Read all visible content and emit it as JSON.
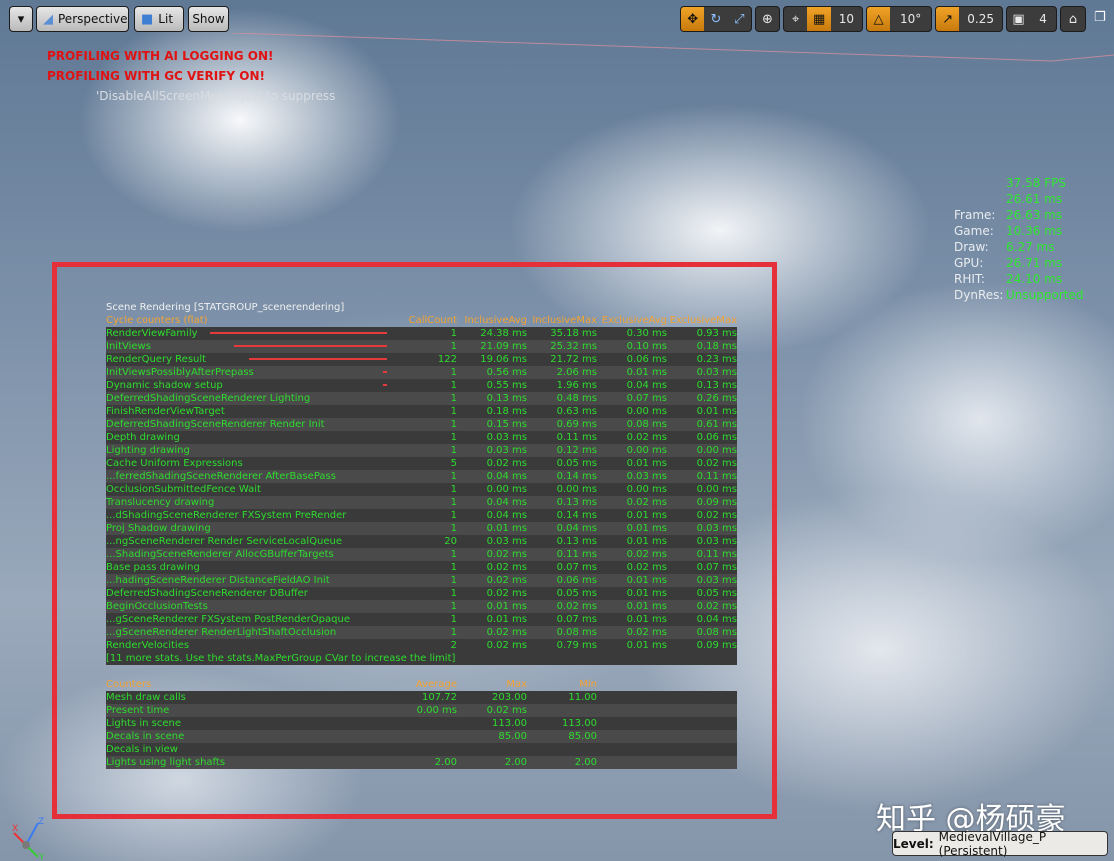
{
  "toolbar": {
    "menu_icon": "chevron-down-icon",
    "perspective_label": "Perspective",
    "lit_label": "Lit",
    "show_label": "Show",
    "grid_snap_value": "10",
    "rotation_snap_value": "10°",
    "scale_snap_value": "0.25",
    "camera_speed_value": "4"
  },
  "warnings": {
    "ai_logging": "PROFILING WITH AI LOGGING ON!",
    "gc_verify": "PROFILING WITH GC VERIFY ON!",
    "suppress_hint": "'DisableAllScreenMessages' to suppress"
  },
  "perf": {
    "fps": "37.58 FPS",
    "ms": "26.61 ms",
    "rows": [
      {
        "label": "Frame:",
        "value": "26.63 ms"
      },
      {
        "label": "Game:",
        "value": "10.36 ms"
      },
      {
        "label": "Draw:",
        "value": "6.27 ms"
      },
      {
        "label": "GPU:",
        "value": "26.71 ms"
      },
      {
        "label": "RHIT:",
        "value": "24.10 ms"
      },
      {
        "label": "DynRes:",
        "value": "Unsupported"
      }
    ]
  },
  "scene_stats": {
    "title": "Scene Rendering [STATGROUP_scenerendering]",
    "cycle_header": "Cycle counters (flat)",
    "columns": [
      "CallCount",
      "InclusiveAvg",
      "InclusiveMax",
      "ExclusiveAvg",
      "ExclusiveMax"
    ],
    "rows": [
      {
        "name": "RenderViewFamily",
        "count": "1",
        "inc_avg": "24.38 ms",
        "inc_max": "35.18 ms",
        "exc_avg": "0.30 ms",
        "exc_max": "0.93 ms",
        "bar": 1.0
      },
      {
        "name": "InitViews",
        "count": "1",
        "inc_avg": "21.09 ms",
        "inc_max": "25.32 ms",
        "exc_avg": "0.10 ms",
        "exc_max": "0.18 ms",
        "bar": 0.865
      },
      {
        "name": "RenderQuery Result",
        "count": "122",
        "inc_avg": "19.06 ms",
        "inc_max": "21.72 ms",
        "exc_avg": "0.06 ms",
        "exc_max": "0.23 ms",
        "bar": 0.78
      },
      {
        "name": "InitViewsPossiblyAfterPrepass",
        "count": "1",
        "inc_avg": "0.56 ms",
        "inc_max": "2.06 ms",
        "exc_avg": "0.01 ms",
        "exc_max": "0.03 ms",
        "bar": 0.023
      },
      {
        "name": "Dynamic shadow setup",
        "count": "1",
        "inc_avg": "0.55 ms",
        "inc_max": "1.96 ms",
        "exc_avg": "0.04 ms",
        "exc_max": "0.13 ms",
        "bar": 0.022
      },
      {
        "name": "DeferredShadingSceneRenderer Lighting",
        "count": "1",
        "inc_avg": "0.13 ms",
        "inc_max": "0.48 ms",
        "exc_avg": "0.07 ms",
        "exc_max": "0.26 ms",
        "bar": 0
      },
      {
        "name": "FinishRenderViewTarget",
        "count": "1",
        "inc_avg": "0.18 ms",
        "inc_max": "0.63 ms",
        "exc_avg": "0.00 ms",
        "exc_max": "0.01 ms",
        "bar": 0
      },
      {
        "name": "DeferredShadingSceneRenderer Render Init",
        "count": "1",
        "inc_avg": "0.15 ms",
        "inc_max": "0.69 ms",
        "exc_avg": "0.08 ms",
        "exc_max": "0.61 ms",
        "bar": 0
      },
      {
        "name": "Depth drawing",
        "count": "1",
        "inc_avg": "0.03 ms",
        "inc_max": "0.11 ms",
        "exc_avg": "0.02 ms",
        "exc_max": "0.06 ms",
        "bar": 0
      },
      {
        "name": "Lighting drawing",
        "count": "1",
        "inc_avg": "0.03 ms",
        "inc_max": "0.12 ms",
        "exc_avg": "0.00 ms",
        "exc_max": "0.00 ms",
        "bar": 0
      },
      {
        "name": "Cache Uniform Expressions",
        "count": "5",
        "inc_avg": "0.02 ms",
        "inc_max": "0.05 ms",
        "exc_avg": "0.01 ms",
        "exc_max": "0.02 ms",
        "bar": 0
      },
      {
        "name": "...ferredShadingSceneRenderer AfterBasePass",
        "count": "1",
        "inc_avg": "0.04 ms",
        "inc_max": "0.14 ms",
        "exc_avg": "0.03 ms",
        "exc_max": "0.11 ms",
        "bar": 0
      },
      {
        "name": "OcclusionSubmittedFence Wait",
        "count": "1",
        "inc_avg": "0.00 ms",
        "inc_max": "0.00 ms",
        "exc_avg": "0.00 ms",
        "exc_max": "0.00 ms",
        "bar": 0
      },
      {
        "name": "Translucency drawing",
        "count": "1",
        "inc_avg": "0.04 ms",
        "inc_max": "0.13 ms",
        "exc_avg": "0.02 ms",
        "exc_max": "0.09 ms",
        "bar": 0
      },
      {
        "name": "...dShadingSceneRenderer FXSystem PreRender",
        "count": "1",
        "inc_avg": "0.04 ms",
        "inc_max": "0.14 ms",
        "exc_avg": "0.01 ms",
        "exc_max": "0.02 ms",
        "bar": 0
      },
      {
        "name": "Proj Shadow drawing",
        "count": "1",
        "inc_avg": "0.01 ms",
        "inc_max": "0.04 ms",
        "exc_avg": "0.01 ms",
        "exc_max": "0.03 ms",
        "bar": 0
      },
      {
        "name": "...ngSceneRenderer Render ServiceLocalQueue",
        "count": "20",
        "inc_avg": "0.03 ms",
        "inc_max": "0.13 ms",
        "exc_avg": "0.01 ms",
        "exc_max": "0.03 ms",
        "bar": 0
      },
      {
        "name": "...ShadingSceneRenderer AllocGBufferTargets",
        "count": "1",
        "inc_avg": "0.02 ms",
        "inc_max": "0.11 ms",
        "exc_avg": "0.02 ms",
        "exc_max": "0.11 ms",
        "bar": 0
      },
      {
        "name": "Base pass drawing",
        "count": "1",
        "inc_avg": "0.02 ms",
        "inc_max": "0.07 ms",
        "exc_avg": "0.02 ms",
        "exc_max": "0.07 ms",
        "bar": 0
      },
      {
        "name": "...hadingSceneRenderer DistanceFieldAO Init",
        "count": "1",
        "inc_avg": "0.02 ms",
        "inc_max": "0.06 ms",
        "exc_avg": "0.01 ms",
        "exc_max": "0.03 ms",
        "bar": 0
      },
      {
        "name": "DeferredShadingSceneRenderer DBuffer",
        "count": "1",
        "inc_avg": "0.02 ms",
        "inc_max": "0.05 ms",
        "exc_avg": "0.01 ms",
        "exc_max": "0.05 ms",
        "bar": 0
      },
      {
        "name": "BeginOcclusionTests",
        "count": "1",
        "inc_avg": "0.01 ms",
        "inc_max": "0.02 ms",
        "exc_avg": "0.01 ms",
        "exc_max": "0.02 ms",
        "bar": 0
      },
      {
        "name": "...gSceneRenderer FXSystem PostRenderOpaque",
        "count": "1",
        "inc_avg": "0.01 ms",
        "inc_max": "0.07 ms",
        "exc_avg": "0.01 ms",
        "exc_max": "0.04 ms",
        "bar": 0
      },
      {
        "name": "...gSceneRenderer RenderLightShaftOcclusion",
        "count": "1",
        "inc_avg": "0.02 ms",
        "inc_max": "0.08 ms",
        "exc_avg": "0.02 ms",
        "exc_max": "0.08 ms",
        "bar": 0
      },
      {
        "name": "RenderVelocities",
        "count": "2",
        "inc_avg": "0.02 ms",
        "inc_max": "0.79 ms",
        "exc_avg": "0.01 ms",
        "exc_max": "0.09 ms",
        "bar": 0
      }
    ],
    "more_stats": "[11 more stats. Use the stats.MaxPerGroup CVar to increase the limit]",
    "counters_header": "Counters",
    "counter_columns": [
      "Average",
      "Max",
      "Min"
    ],
    "counters": [
      {
        "name": "Mesh draw calls",
        "avg": "107.72",
        "max": "203.00",
        "min": "11.00"
      },
      {
        "name": "Present time",
        "avg": "0.00 ms",
        "max": "0.02 ms",
        "min": ""
      },
      {
        "name": "Lights in scene",
        "avg": "",
        "max": "113.00",
        "min": "113.00"
      },
      {
        "name": "Decals in scene",
        "avg": "",
        "max": "85.00",
        "min": "85.00"
      },
      {
        "name": "Decals in view",
        "avg": "",
        "max": "",
        "min": ""
      },
      {
        "name": "Lights using light shafts",
        "avg": "2.00",
        "max": "2.00",
        "min": "2.00"
      }
    ]
  },
  "watermark": "知乎 @杨硕豪",
  "level": {
    "label": "Level:",
    "value": "MedievalVillage_P (Persistent)"
  },
  "axis": {
    "x": "X",
    "y": "Y",
    "z": "Z"
  },
  "colors": {
    "stat_green": "#2edc2e",
    "header_orange": "#f4a331",
    "warning_red": "#e01212",
    "highlight_red": "#e5303a"
  }
}
